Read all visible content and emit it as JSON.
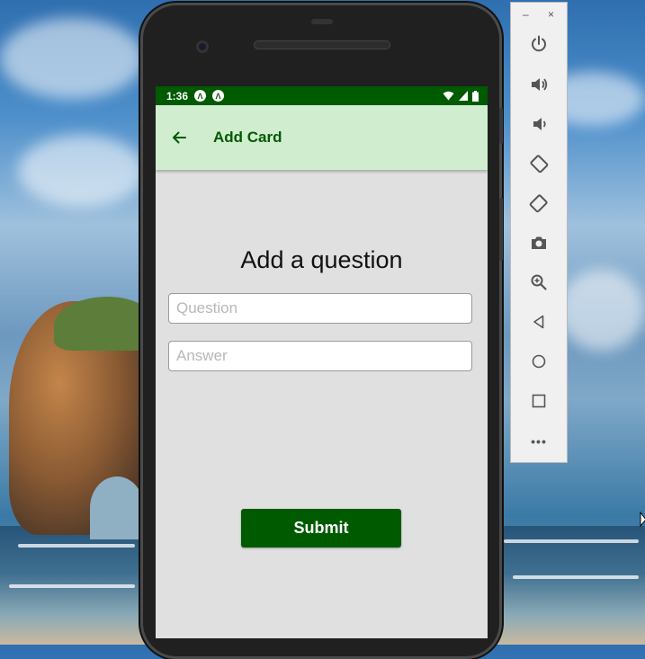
{
  "statusbar": {
    "time": "1:36",
    "app_icon_glyph": "Λ"
  },
  "appbar": {
    "title": "Add Card",
    "back_icon": "arrow-left-icon"
  },
  "form": {
    "heading": "Add a question",
    "question_placeholder": "Question",
    "question_value": "",
    "answer_placeholder": "Answer",
    "answer_value": "",
    "submit_label": "Submit"
  },
  "emulator_toolbar": {
    "window_controls": {
      "minimize": "–",
      "close": "×"
    },
    "buttons": [
      "power-icon",
      "volume-up-icon",
      "volume-down-icon",
      "rotate-left-icon",
      "rotate-right-icon",
      "camera-icon",
      "zoom-icon",
      "back-icon",
      "home-icon",
      "overview-icon",
      "more-icon"
    ],
    "more_glyph": "•••"
  },
  "colors": {
    "status_bar": "#005a00",
    "app_bar": "#d1edcf",
    "accent": "#005a00",
    "screen_bg": "#e0e0e0"
  }
}
